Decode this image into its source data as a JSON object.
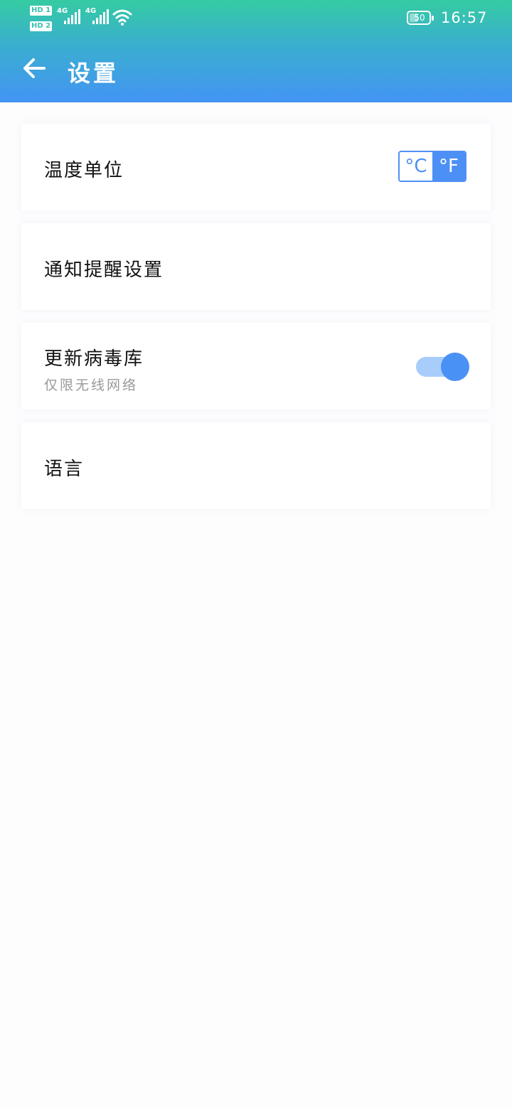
{
  "status_bar": {
    "sim1": "HD 1",
    "sim2": "HD 2",
    "network1": "4G",
    "network2": "4G",
    "battery": "50",
    "time": "16:57"
  },
  "header": {
    "back_icon": "arrow-left-icon",
    "title": "设置"
  },
  "settings": {
    "temperature_unit": {
      "label": "温度单位",
      "celsius": "°C",
      "fahrenheit": "°F",
      "selected": "°F"
    },
    "notifications": {
      "label": "通知提醒设置"
    },
    "virus_db": {
      "label": "更新病毒库",
      "sub": "仅限无线网络",
      "enabled": true
    },
    "language": {
      "label": "语言"
    }
  },
  "colors": {
    "accent": "#4a91f5",
    "header_top": "#35cba2",
    "header_bottom": "#4494f4"
  }
}
